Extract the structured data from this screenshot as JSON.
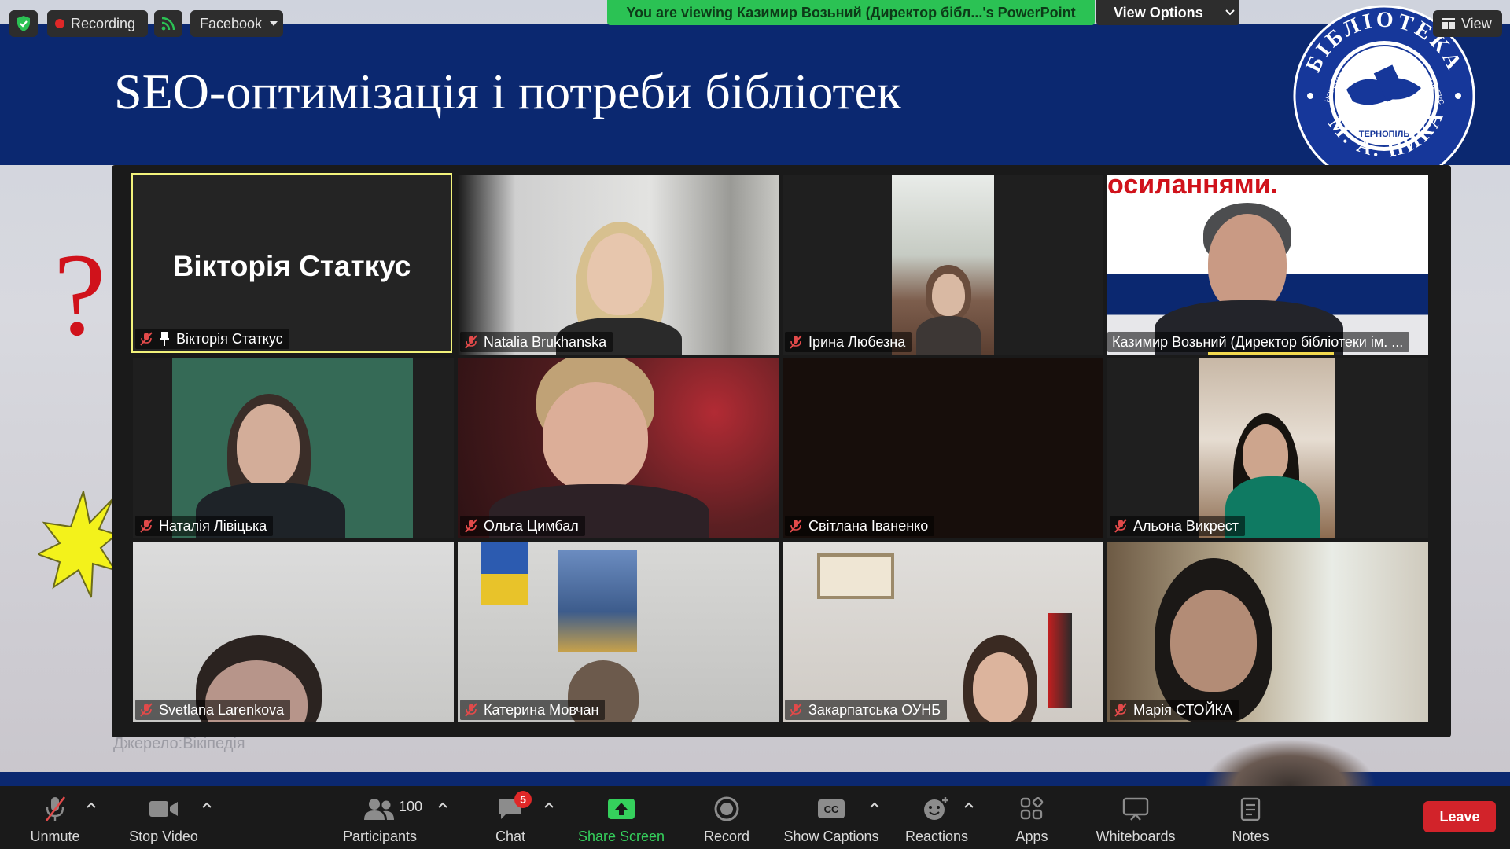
{
  "slide": {
    "title": "SEO-оптимізація і потреби бібліотек",
    "source": "Джерело:Вікіпедія",
    "question_mark": "?",
    "seal_top_text": "БІБЛІОТЕКА",
    "seal_ring_text": "ЗАХІДНОУКРАЇНСЬКИЙ НАЦІОНАЛЬНИЙ УНІВЕРСИТЕТ",
    "seal_city": "ТЕРНОПІЛЬ",
    "seal_bottom_text": "ІМ. А. НИКА"
  },
  "top_bar": {
    "security_icon": "shield-check-icon",
    "recording_label": "Recording",
    "rss_icon": "rss-icon",
    "facebook_label": "Facebook",
    "viewing_banner": "You are viewing Казимир Возьний (Директор бібл...'s PowerPoint",
    "view_options_label": "View Options",
    "view_label": "View"
  },
  "participants": [
    {
      "name": "Вікторія Статкус",
      "display_name": "Вікторія Статкус",
      "muted": true,
      "pinned": true,
      "video": false
    },
    {
      "name": "Natalia Brukhanska",
      "muted": true,
      "video": true
    },
    {
      "name": "Ірина Любезна",
      "muted": true,
      "video": true
    },
    {
      "name": "Казимир Возьний (Директор бібліотеки ім. ...",
      "muted": false,
      "active_speaker": true,
      "video": true,
      "background_text": "осиланнями."
    },
    {
      "name": "Наталія Лівіцька",
      "muted": true,
      "video": true
    },
    {
      "name": "Ольга Цимбал",
      "muted": true,
      "video": true
    },
    {
      "name": "Світлана Іваненко",
      "muted": true,
      "video": false
    },
    {
      "name": "Альона Викрест",
      "muted": true,
      "video": true
    },
    {
      "name": "Svetlana Larenkova",
      "muted": true,
      "video": true
    },
    {
      "name": "Катерина Мовчан",
      "muted": true,
      "video": true
    },
    {
      "name": "Закарпатська ОУНБ",
      "muted": true,
      "video": true
    },
    {
      "name": "Марія СТОЙКА",
      "muted": true,
      "video": true
    }
  ],
  "toolbar": {
    "unmute": "Unmute",
    "stop_video": "Stop Video",
    "participants": "Participants",
    "participants_count": "100",
    "chat": "Chat",
    "chat_badge": "5",
    "share_screen": "Share Screen",
    "record": "Record",
    "show_captions": "Show Captions",
    "captions_icon_text": "CC",
    "reactions": "Reactions",
    "apps": "Apps",
    "whiteboards": "Whiteboards",
    "notes": "Notes",
    "leave": "Leave"
  },
  "colors": {
    "slide_band": "#0b2870",
    "banner_green": "#2bc254",
    "leave_red": "#d2232a",
    "mute_red": "#e24a4a",
    "active_speaker": "#f2f27b"
  }
}
